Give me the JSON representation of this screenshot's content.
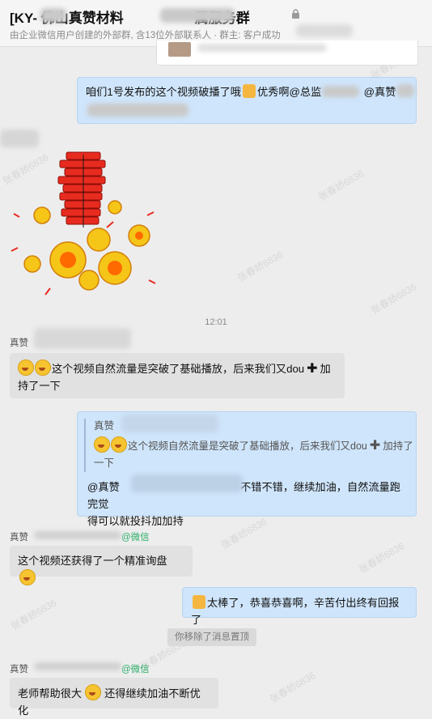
{
  "header": {
    "title": "[KY-     佛山真赞材料",
    "title_suffix": "属服务群",
    "subtitle": "由企业微信用户创建的外部群, 含13位外部联系人 · 群主: 客户成功"
  },
  "watermark": "张春娇6836",
  "messages": {
    "m1": {
      "text": "咱们1号发布的这个视频破播了哦",
      "text2": "优秀啊@总监",
      "text3": "@真赞"
    },
    "time1": "12:01",
    "m2": {
      "sender": "真赞",
      "text": "这个视频自然流量是突破了基础播放，后来我们又dou",
      "text_cont": "加持了一下"
    },
    "m3": {
      "quote_sender": "真赞",
      "quote_text": "这个视频自然流量是突破了基础播放，后来我们又dou",
      "quote_cont": "加持了一下",
      "mention": "@真赞",
      "text": "不错不错，继续加油，自然流量跑完觉",
      "text_cont": "得可以就投抖加加持"
    },
    "m4": {
      "sender": "真赞",
      "source": "@微信",
      "text": "这个视频还获得了一个精准询盘"
    },
    "m5": {
      "text": "太棒了，恭喜恭喜啊，辛苦付出终有回报了"
    },
    "system": "你移除了消息置顶",
    "m6": {
      "sender": "真赞",
      "source": "@微信",
      "text": "老师帮助很大",
      "text_cont": "还得继续加油不断优化"
    }
  },
  "colors": {
    "my_bubble": "#cfe5fb",
    "other_bubble": "#e1e1e1",
    "wechat_green": "#2aae67"
  },
  "icons": [
    "lock-icon",
    "grin-emoji-icon",
    "plus-icon",
    "thumbs-up-icon",
    "thinking-emoji-icon",
    "firecracker-sticker"
  ]
}
